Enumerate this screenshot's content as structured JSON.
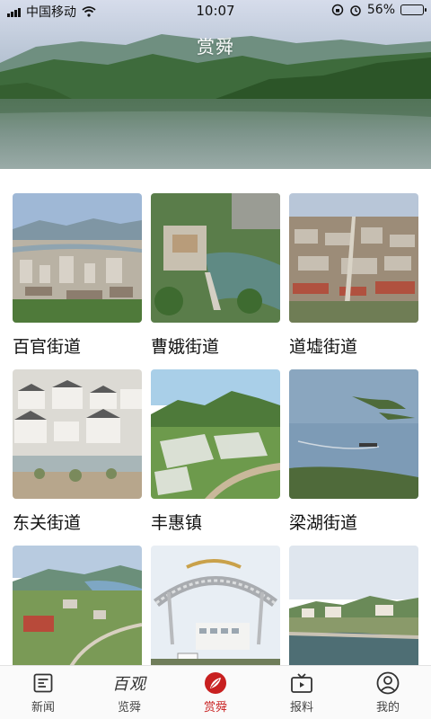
{
  "status": {
    "carrier": "中国移动",
    "time": "10:07",
    "battery": "56%",
    "battery_level": 0.56
  },
  "header": {
    "title": "赏舜"
  },
  "grid": {
    "items": [
      {
        "label": "百官街道"
      },
      {
        "label": "曹娥街道"
      },
      {
        "label": "道墟街道"
      },
      {
        "label": "东关街道"
      },
      {
        "label": "丰惠镇"
      },
      {
        "label": "梁湖街道"
      },
      {
        "label": ""
      },
      {
        "label": ""
      },
      {
        "label": ""
      }
    ]
  },
  "tabbar": {
    "tabs": [
      {
        "label": "新闻",
        "icon": "newspaper-icon"
      },
      {
        "label": "览舜",
        "icon": "calligraphy-logo-icon",
        "logo_text": "百观"
      },
      {
        "label": "赏舜",
        "icon": "leaf-icon",
        "active": true
      },
      {
        "label": "报料",
        "icon": "tv-icon"
      },
      {
        "label": "我的",
        "icon": "user-icon"
      }
    ]
  },
  "colors": {
    "accent": "#c82020",
    "text": "#111111",
    "tab_text": "#444444"
  }
}
